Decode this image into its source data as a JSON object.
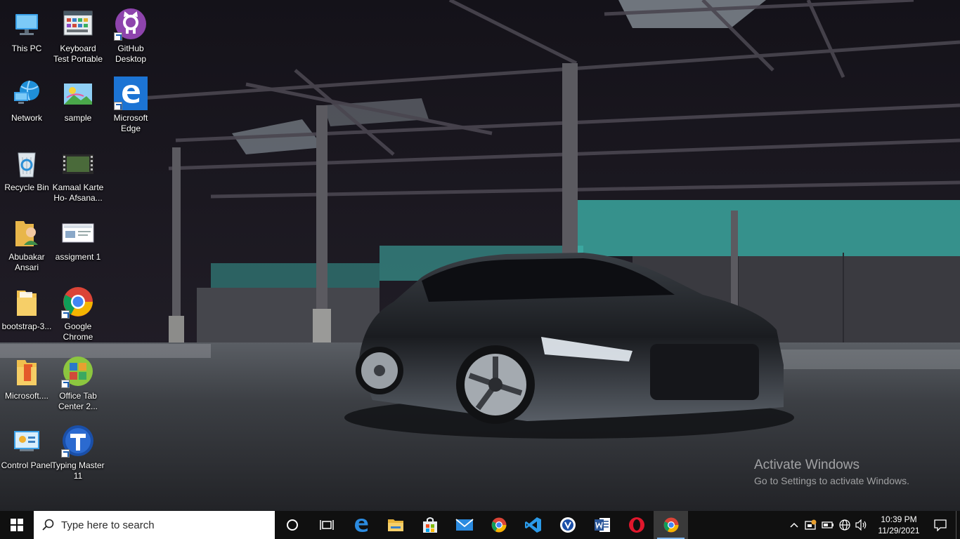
{
  "desktop": {
    "icons": [
      {
        "label": "This PC",
        "icon": "this-pc-icon"
      },
      {
        "label": "Keyboard Test Portable",
        "icon": "keyboard-test-icon"
      },
      {
        "label": "GitHub Desktop",
        "icon": "github-icon"
      },
      {
        "label": "Network",
        "icon": "network-icon"
      },
      {
        "label": "sample",
        "icon": "image-file-icon"
      },
      {
        "label": "Microsoft Edge",
        "icon": "edge-icon"
      },
      {
        "label": "Recycle Bin",
        "icon": "recycle-bin-icon"
      },
      {
        "label": "Kamaal Karte Ho- Afsana...",
        "icon": "video-file-icon"
      },
      {
        "label": "Abubakar Ansari",
        "icon": "user-folder-icon"
      },
      {
        "label": "assigment 1",
        "icon": "document-thumbnail-icon"
      },
      {
        "label": "bootstrap-3...",
        "icon": "folder-icon"
      },
      {
        "label": "Google Chrome",
        "icon": "chrome-icon"
      },
      {
        "label": "Microsoft....",
        "icon": "office-folder-icon"
      },
      {
        "label": "Office Tab Center 2...",
        "icon": "office-tab-icon"
      },
      {
        "label": "Control Panel",
        "icon": "control-panel-icon"
      },
      {
        "label": "Typing Master 11",
        "icon": "typing-master-icon"
      }
    ]
  },
  "watermark": {
    "title": "Activate Windows",
    "subtitle": "Go to Settings to activate Windows."
  },
  "taskbar": {
    "search_placeholder": "Type here to search",
    "pinned": [
      {
        "name": "cortana",
        "icon": "cortana-circle-icon"
      },
      {
        "name": "task-view",
        "icon": "task-view-icon"
      },
      {
        "name": "edge",
        "icon": "edge-icon"
      },
      {
        "name": "file-explorer",
        "icon": "folder-icon"
      },
      {
        "name": "store",
        "icon": "store-bag-icon"
      },
      {
        "name": "mail",
        "icon": "mail-icon"
      },
      {
        "name": "chrome",
        "icon": "chrome-icon"
      },
      {
        "name": "vscode",
        "icon": "vscode-icon"
      },
      {
        "name": "app",
        "icon": "circle-app-icon"
      },
      {
        "name": "word",
        "icon": "word-icon"
      },
      {
        "name": "opera",
        "icon": "opera-icon"
      },
      {
        "name": "chrome-running",
        "icon": "chrome-icon"
      }
    ],
    "clock": {
      "time": "10:39 PM",
      "date": "11/29/2021"
    }
  },
  "colors": {
    "taskbar_bg": "#101010",
    "accent": "#0078d7",
    "search_bg": "#ffffff"
  }
}
